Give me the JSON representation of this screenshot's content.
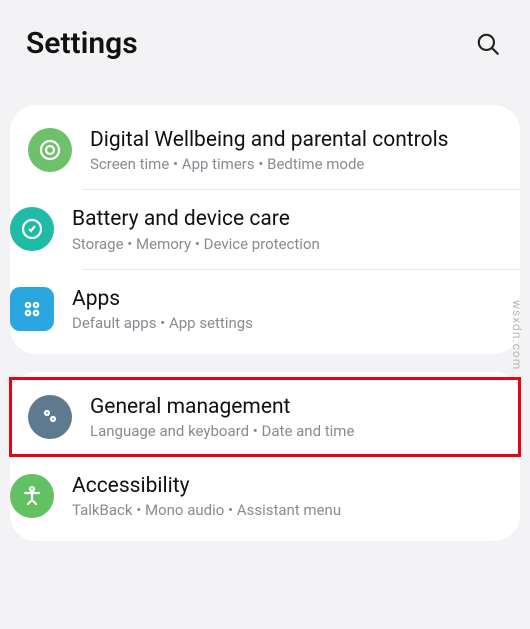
{
  "header": {
    "title": "Settings"
  },
  "groups": [
    {
      "items": [
        {
          "id": "digital-wellbeing",
          "title": "Digital Wellbeing and parental controls",
          "subtitle": "Screen time  •  App timers  •  Bedtime mode",
          "color": "c-green",
          "shape": "round",
          "icon": "wellbeing-icon"
        },
        {
          "id": "battery-device-care",
          "title": "Battery and device care",
          "subtitle": "Storage  •  Memory  •  Device protection",
          "color": "c-teal",
          "shape": "round",
          "icon": "battery-care-icon"
        },
        {
          "id": "apps",
          "title": "Apps",
          "subtitle": "Default apps  •  App settings",
          "color": "c-blue",
          "shape": "square",
          "icon": "apps-icon"
        }
      ]
    },
    {
      "items": [
        {
          "id": "general-management",
          "title": "General management",
          "subtitle": "Language and keyboard  •  Date and time",
          "color": "c-slate",
          "shape": "round",
          "icon": "sliders-icon",
          "highlight": true
        },
        {
          "id": "accessibility",
          "title": "Accessibility",
          "subtitle": "TalkBack  •  Mono audio  •  Assistant menu",
          "color": "c-lime",
          "shape": "round",
          "icon": "accessibility-icon"
        }
      ]
    }
  ],
  "watermark": "wsxdn.com"
}
